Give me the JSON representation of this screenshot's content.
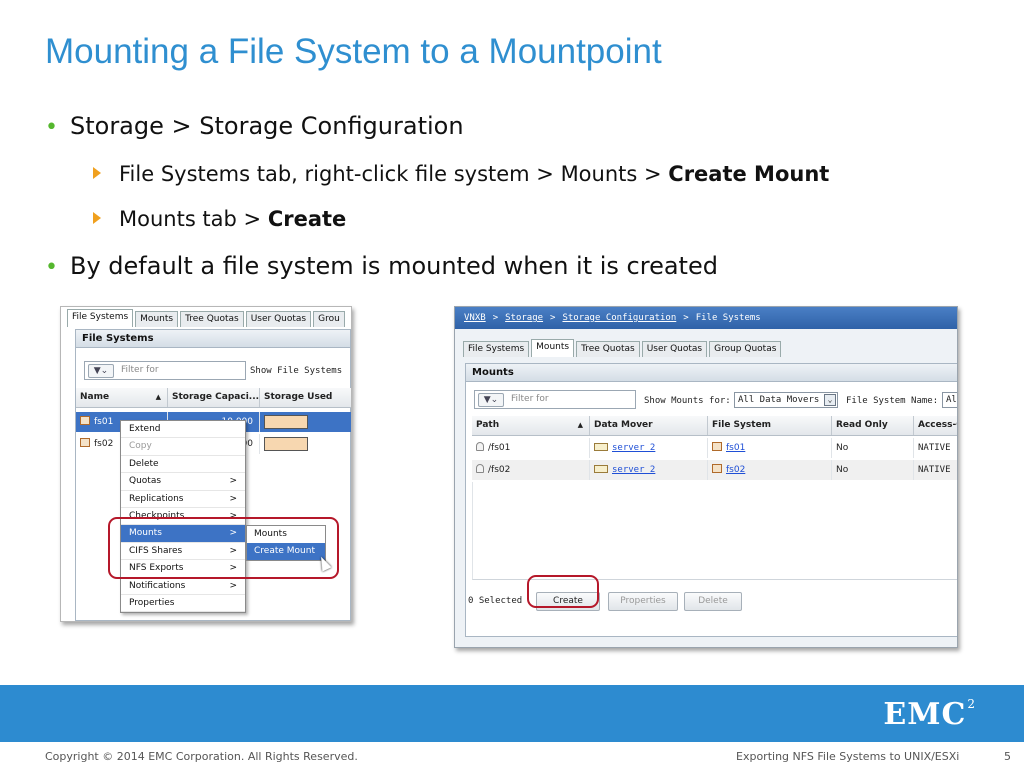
{
  "slide": {
    "title": "Mounting a File System to a Mountpoint",
    "bullets": {
      "b1": "Storage > Storage Configuration",
      "b1_sub1_pre": "File Systems tab, right-click file system > Mounts > ",
      "b1_sub1_bold": "Create Mount",
      "b1_sub2_pre": "Mounts tab > ",
      "b1_sub2_bold": "Create",
      "b2": "By default a file system is mounted  when it is created"
    }
  },
  "left_shot": {
    "tabs": [
      "File Systems",
      "Mounts",
      "Tree Quotas",
      "User Quotas",
      "Grou"
    ],
    "panel_title": "File Systems",
    "filter_placeholder": "Filter for",
    "show_label": "Show File Systems",
    "columns": [
      "Name",
      "Storage Capaci...",
      "Storage Used"
    ],
    "rows": [
      {
        "name": "fs01",
        "capacity": "10,000"
      },
      {
        "name": "fs02",
        "capacity": "00"
      }
    ],
    "context_menu": [
      {
        "label": "Extend",
        "arrow": ""
      },
      {
        "label": "Copy",
        "arrow": ""
      },
      {
        "label": "Delete",
        "arrow": ""
      },
      {
        "label": "Quotas",
        "arrow": ">"
      },
      {
        "label": "Replications",
        "arrow": ">"
      },
      {
        "label": "Checkpoints",
        "arrow": ">"
      },
      {
        "label": "Mounts",
        "arrow": ">"
      },
      {
        "label": "CIFS Shares",
        "arrow": ">"
      },
      {
        "label": "NFS Exports",
        "arrow": ">"
      },
      {
        "label": "Notifications",
        "arrow": ">"
      },
      {
        "label": "Properties",
        "arrow": ""
      }
    ],
    "submenu": [
      "Mounts",
      "Create Mount"
    ]
  },
  "right_shot": {
    "breadcrumb": {
      "a": "VNXB",
      "b": "Storage",
      "c": "Storage Configuration",
      "d": "File Systems",
      "sep": ">"
    },
    "tabs": [
      "File Systems",
      "Mounts",
      "Tree Quotas",
      "User Quotas",
      "Group Quotas"
    ],
    "panel_title": "Mounts",
    "filter_placeholder": "Filter for",
    "show_label": "Show Mounts for:",
    "show_value": "All Data Movers",
    "fsname_label": "File System Name:",
    "fsname_value": "Al",
    "columns": [
      "Path",
      "Data Mover",
      "File System",
      "Read Only",
      "Access-C"
    ],
    "rows": [
      {
        "path": "/fs01",
        "mover": "server_2",
        "fs": "fs01",
        "ro": "No",
        "access": "NATIVE"
      },
      {
        "path": "/fs02",
        "mover": "server_2",
        "fs": "fs02",
        "ro": "No",
        "access": "NATIVE"
      }
    ],
    "selected": "0 Selected",
    "buttons": {
      "create": "Create",
      "properties": "Properties",
      "delete": "Delete"
    }
  },
  "footer": {
    "logo": "EMC",
    "logo_sup": "2",
    "copyright": "Copyright © 2014 EMC Corporation. All Rights Reserved.",
    "topic": "Exporting NFS File Systems to UNIX/ESXi",
    "page": "5"
  },
  "colors": {
    "title": "#2f8fd0",
    "accent_band": "#2d8bd0",
    "highlight": "#b5182a",
    "selection": "#3d73c5"
  }
}
